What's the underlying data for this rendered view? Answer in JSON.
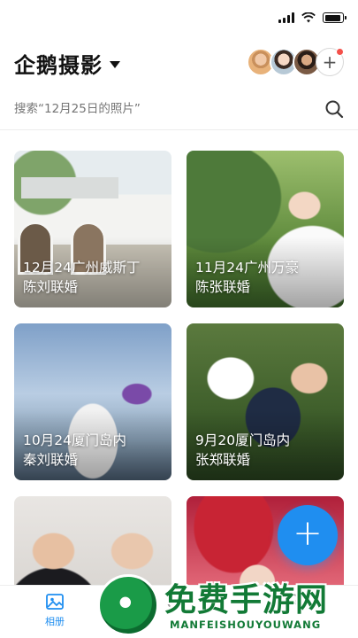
{
  "status_bar": {
    "icons": [
      "signal-icon",
      "wifi-icon",
      "battery-icon"
    ]
  },
  "header": {
    "title": "企鹅摄影",
    "add_member_label": "+"
  },
  "search": {
    "placeholder": "搜索“12月25日的照片”"
  },
  "albums": [
    {
      "line1": "12月24广州威斯丁",
      "line2": "陈刘联婚"
    },
    {
      "line1": "11月24广州万豪",
      "line2": "陈张联婚"
    },
    {
      "line1": "10月24厦门岛内",
      "line2": "秦刘联婚"
    },
    {
      "line1": "9月20厦门岛内",
      "line2": "张郑联婚"
    },
    {
      "line1": "",
      "line2": ""
    },
    {
      "line1": "",
      "line2": ""
    }
  ],
  "fab": {
    "label": "+"
  },
  "tabbar": {
    "album_label": "相册",
    "moment_label": "",
    "me_label": ""
  },
  "watermark": {
    "title": "免费手游网",
    "subtitle": "MANFEISHOUYOUWANG"
  },
  "colors": {
    "accent": "#1f8ef0",
    "notification_dot": "#f4504a",
    "watermark_green": "#127a36"
  }
}
